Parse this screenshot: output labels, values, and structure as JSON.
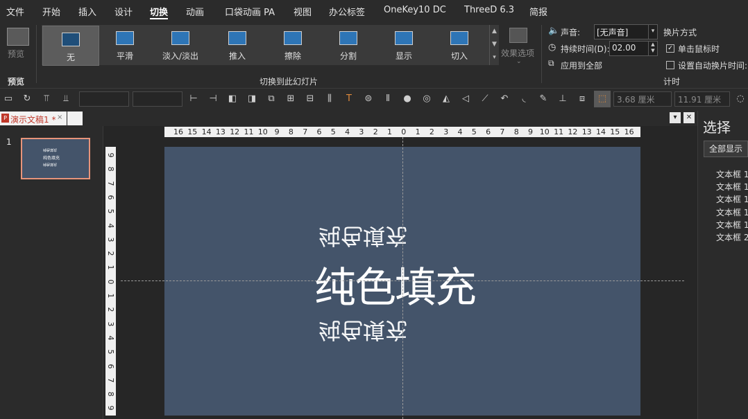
{
  "menu": {
    "items": [
      "文件",
      "开始",
      "插入",
      "设计",
      "切换",
      "动画",
      "口袋动画 PA",
      "视图",
      "办公标签",
      "OneKey10 DC",
      "ThreeD 6.3",
      "简报"
    ],
    "active": "切换"
  },
  "ribbon": {
    "preview": {
      "button_label": "预览",
      "group_label": "预览"
    },
    "transitions": {
      "group_label": "切换到此幻灯片",
      "items": [
        "无",
        "平滑",
        "淡入/淡出",
        "推入",
        "擦除",
        "分割",
        "显示",
        "切入"
      ],
      "selected": "无",
      "effect_options_label": "效果选项"
    },
    "timing": {
      "group_label": "计时",
      "sound_label": "声音:",
      "sound_value": "[无声音]",
      "duration_label": "持续时间(D):",
      "duration_value": "02.00",
      "apply_all_label": "应用到全部",
      "advance_label": "换片方式",
      "on_click_label": "单击鼠标时",
      "on_click_checked": true,
      "auto_advance_label": "设置自动换片时间:",
      "auto_advance_checked": false
    }
  },
  "toolbar": {
    "width_value": "3.68 厘米",
    "height_value": "11.91 厘米"
  },
  "doc_tabs": {
    "active_tab": "演示文稿1 *",
    "close_glyph": "×",
    "dropdown_glyph": "▾",
    "close_window_glyph": "✕"
  },
  "thumbnails": {
    "slide_number": "1"
  },
  "rulers": {
    "horizontal": [
      "16",
      "15",
      "14",
      "13",
      "12",
      "11",
      "10",
      "9",
      "8",
      "7",
      "6",
      "5",
      "4",
      "3",
      "2",
      "1",
      "0",
      "1",
      "2",
      "3",
      "4",
      "5",
      "6",
      "7",
      "8",
      "9",
      "10",
      "11",
      "12",
      "13",
      "14",
      "15",
      "16"
    ],
    "vertical": [
      "9",
      "8",
      "7",
      "6",
      "5",
      "4",
      "3",
      "2",
      "1",
      "0",
      "1",
      "2",
      "3",
      "4",
      "5",
      "6",
      "7",
      "8",
      "9"
    ]
  },
  "slide": {
    "background": "#44546a",
    "text_top": "纯色填充",
    "text_main": "纯色填充",
    "text_bottom": "纯色填充"
  },
  "selection_pane": {
    "title": "选择",
    "show_all_label": "全部显示",
    "items": [
      "文本框 1",
      "文本框 1",
      "文本框 1",
      "文本框 1",
      "文本框 1",
      "文本框 2"
    ]
  },
  "colors": {
    "app_bg": "#2b2b2b",
    "slide_bg": "#44546a",
    "thumb_border": "#e8947a",
    "tab_text": "#c0392b"
  }
}
